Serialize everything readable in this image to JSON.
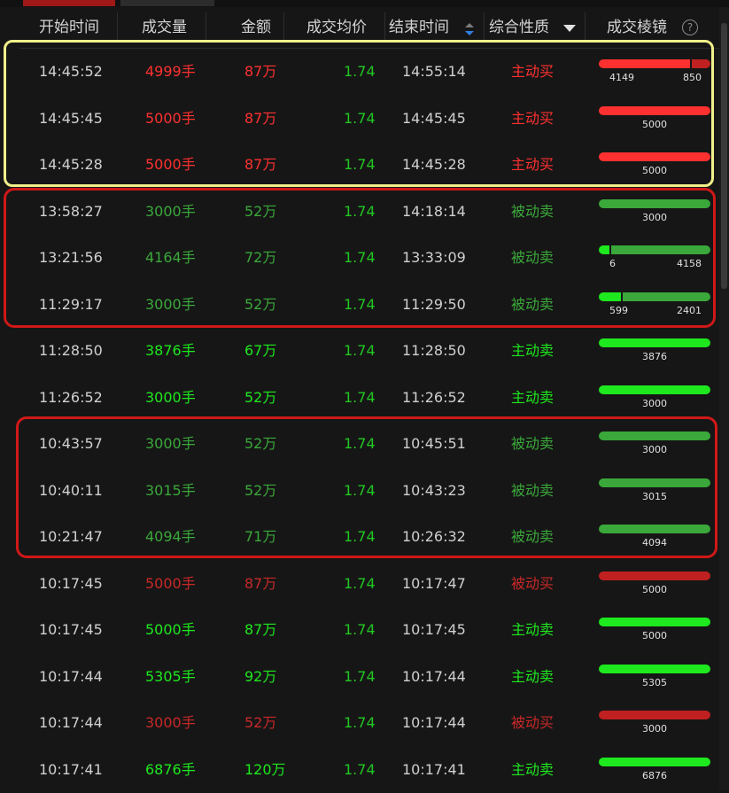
{
  "header": {
    "start_time": "开始时间",
    "volume": "成交量",
    "amount": "金额",
    "avg_price": "成交均价",
    "end_time": "结束时间",
    "nature": "综合性质",
    "prism": "成交棱镜",
    "help": "?"
  },
  "colors": {
    "red": "#ff3030",
    "dark_red": "#c82828",
    "green": "#1ee81e",
    "dark_green": "#3aa83a",
    "price_green": "#22c622",
    "yellow_box": "#f0f08a",
    "red_box": "#d01818"
  },
  "rows": [
    {
      "start": "14:45:52",
      "volume": "4999手",
      "amount": "87万",
      "price": "1.74",
      "end": "14:55:14",
      "nature": "主动买",
      "tone": "red",
      "bar": [
        {
          "frac": 0.83,
          "color": "#ff3030"
        },
        {
          "frac": 0.17,
          "color": "#c02020"
        }
      ],
      "labels": [
        "4149",
        "850"
      ]
    },
    {
      "start": "14:45:45",
      "volume": "5000手",
      "amount": "87万",
      "price": "1.74",
      "end": "14:45:45",
      "nature": "主动买",
      "tone": "red",
      "bar": [
        {
          "frac": 1,
          "color": "#ff3030"
        }
      ],
      "labels": [
        "5000"
      ]
    },
    {
      "start": "14:45:28",
      "volume": "5000手",
      "amount": "87万",
      "price": "1.74",
      "end": "14:45:28",
      "nature": "主动买",
      "tone": "red",
      "bar": [
        {
          "frac": 1,
          "color": "#ff3030"
        }
      ],
      "labels": [
        "5000"
      ]
    },
    {
      "start": "13:58:27",
      "volume": "3000手",
      "amount": "52万",
      "price": "1.74",
      "end": "14:18:14",
      "nature": "被动卖",
      "tone": "dgreen",
      "bar": [
        {
          "frac": 1,
          "color": "#3aa83a"
        }
      ],
      "labels": [
        "3000"
      ]
    },
    {
      "start": "13:21:56",
      "volume": "4164手",
      "amount": "72万",
      "price": "1.74",
      "end": "13:33:09",
      "nature": "被动卖",
      "tone": "dgreen",
      "bar": [
        {
          "frac": 0.1,
          "color": "#1ee81e"
        },
        {
          "frac": 0.9,
          "color": "#3aa83a"
        }
      ],
      "labels": [
        "6",
        "4158"
      ]
    },
    {
      "start": "11:29:17",
      "volume": "3000手",
      "amount": "52万",
      "price": "1.74",
      "end": "11:29:50",
      "nature": "被动卖",
      "tone": "dgreen",
      "bar": [
        {
          "frac": 0.2,
          "color": "#1ee81e"
        },
        {
          "frac": 0.8,
          "color": "#3aa83a"
        }
      ],
      "labels": [
        "599",
        "2401"
      ]
    },
    {
      "start": "11:28:50",
      "volume": "3876手",
      "amount": "67万",
      "price": "1.74",
      "end": "11:28:50",
      "nature": "主动卖",
      "tone": "green",
      "bar": [
        {
          "frac": 1,
          "color": "#1ee81e"
        }
      ],
      "labels": [
        "3876"
      ]
    },
    {
      "start": "11:26:52",
      "volume": "3000手",
      "amount": "52万",
      "price": "1.74",
      "end": "11:26:52",
      "nature": "主动卖",
      "tone": "green",
      "bar": [
        {
          "frac": 1,
          "color": "#1ee81e"
        }
      ],
      "labels": [
        "3000"
      ]
    },
    {
      "start": "10:43:57",
      "volume": "3000手",
      "amount": "52万",
      "price": "1.74",
      "end": "10:45:51",
      "nature": "被动卖",
      "tone": "dgreen",
      "bar": [
        {
          "frac": 1,
          "color": "#3aa83a"
        }
      ],
      "labels": [
        "3000"
      ]
    },
    {
      "start": "10:40:11",
      "volume": "3015手",
      "amount": "52万",
      "price": "1.74",
      "end": "10:43:23",
      "nature": "被动卖",
      "tone": "dgreen",
      "bar": [
        {
          "frac": 1,
          "color": "#3aa83a"
        }
      ],
      "labels": [
        "3015"
      ]
    },
    {
      "start": "10:21:47",
      "volume": "4094手",
      "amount": "71万",
      "price": "1.74",
      "end": "10:26:32",
      "nature": "被动卖",
      "tone": "dgreen",
      "bar": [
        {
          "frac": 1,
          "color": "#3aa83a"
        }
      ],
      "labels": [
        "4094"
      ]
    },
    {
      "start": "10:17:45",
      "volume": "5000手",
      "amount": "87万",
      "price": "1.74",
      "end": "10:17:47",
      "nature": "被动买",
      "tone": "dred",
      "bar": [
        {
          "frac": 1,
          "color": "#c02020"
        }
      ],
      "labels": [
        "5000"
      ]
    },
    {
      "start": "10:17:45",
      "volume": "5000手",
      "amount": "87万",
      "price": "1.74",
      "end": "10:17:45",
      "nature": "主动卖",
      "tone": "green",
      "bar": [
        {
          "frac": 1,
          "color": "#1ee81e"
        }
      ],
      "labels": [
        "5000"
      ]
    },
    {
      "start": "10:17:44",
      "volume": "5305手",
      "amount": "92万",
      "price": "1.74",
      "end": "10:17:44",
      "nature": "主动卖",
      "tone": "green",
      "bar": [
        {
          "frac": 1,
          "color": "#1ee81e"
        }
      ],
      "labels": [
        "5305"
      ]
    },
    {
      "start": "10:17:44",
      "volume": "3000手",
      "amount": "52万",
      "price": "1.74",
      "end": "10:17:44",
      "nature": "被动买",
      "tone": "dred",
      "bar": [
        {
          "frac": 1,
          "color": "#c02020"
        }
      ],
      "labels": [
        "3000"
      ]
    },
    {
      "start": "10:17:41",
      "volume": "6876手",
      "amount": "120万",
      "price": "1.74",
      "end": "10:17:41",
      "nature": "主动卖",
      "tone": "green",
      "bar": [
        {
          "frac": 1,
          "color": "#1ee81e"
        }
      ],
      "labels": [
        "6876"
      ]
    }
  ]
}
